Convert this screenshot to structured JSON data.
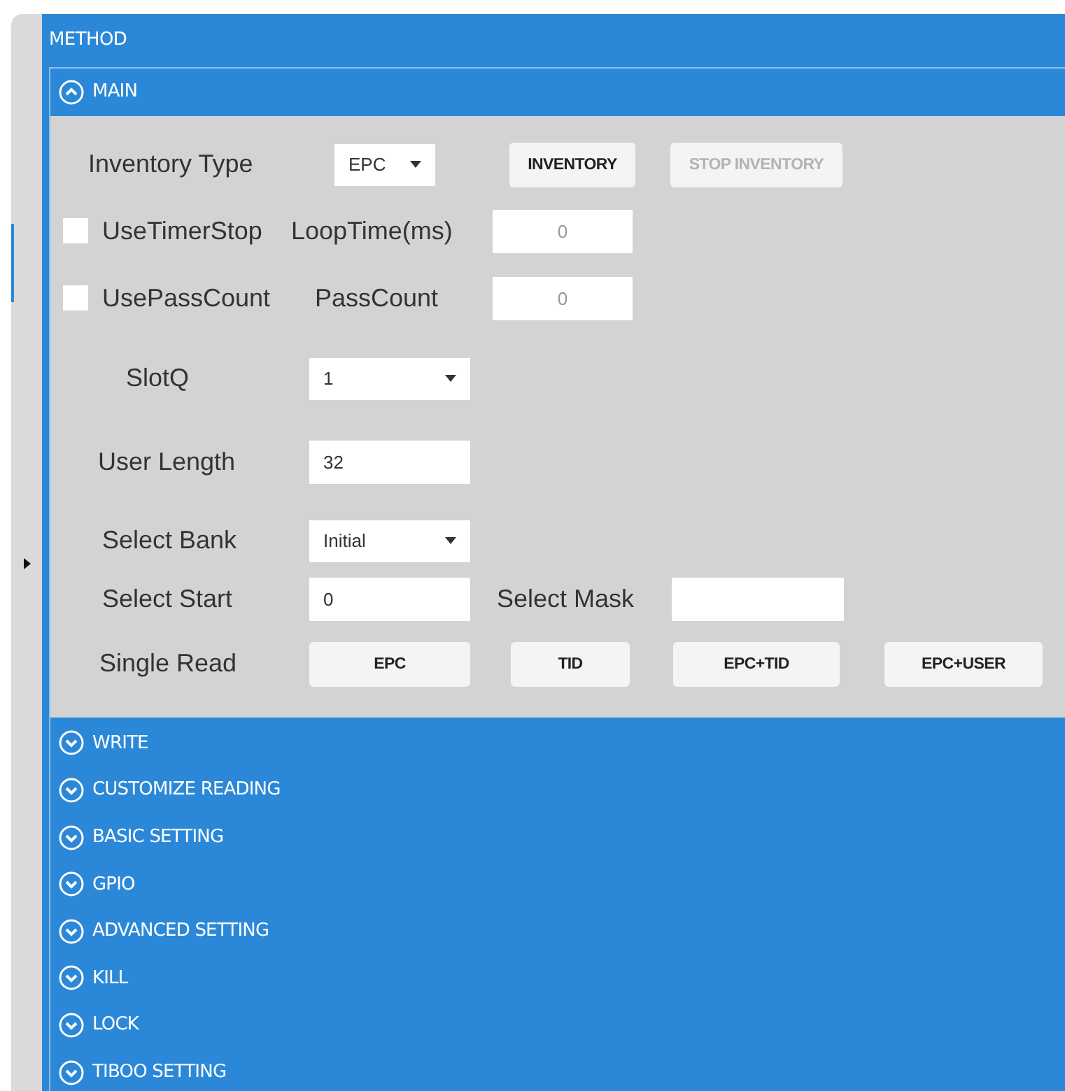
{
  "panel": {
    "title": "METHOD"
  },
  "sections": [
    {
      "title": "MAIN",
      "expanded": true
    },
    {
      "title": "WRITE",
      "expanded": false
    },
    {
      "title": "CUSTOMIZE READING",
      "expanded": false
    },
    {
      "title": "BASIC SETTING",
      "expanded": false
    },
    {
      "title": "GPIO",
      "expanded": false
    },
    {
      "title": "ADVANCED SETTING",
      "expanded": false
    },
    {
      "title": "KILL",
      "expanded": false
    },
    {
      "title": "LOCK",
      "expanded": false
    },
    {
      "title": "TIBOO SETTING",
      "expanded": false
    }
  ],
  "main": {
    "inventory_type": {
      "label": "Inventory Type",
      "value": "EPC"
    },
    "inventory_buttons": [
      {
        "label": "INVENTORY",
        "disabled": false
      },
      {
        "label": "STOP INVENTORY",
        "disabled": true
      }
    ],
    "timer": {
      "checkbox_label": "UseTimerStop",
      "checked": false,
      "field_label": "LoopTime(ms)",
      "value": "0"
    },
    "pass": {
      "checkbox_label": "UsePassCount",
      "checked": false,
      "field_label": "PassCount",
      "value": "0"
    },
    "slotq": {
      "label": "SlotQ",
      "value": "1"
    },
    "user_length": {
      "label": "User Length",
      "value": "32"
    },
    "select_bank": {
      "label": "Select Bank",
      "value": "Initial"
    },
    "select_start": {
      "label": "Select Start",
      "value": "0"
    },
    "select_mask": {
      "label": "Select Mask"
    },
    "single_read": {
      "label": "Single Read",
      "buttons": [
        "EPC",
        "TID",
        "EPC+TID",
        "EPC+USER"
      ]
    }
  }
}
